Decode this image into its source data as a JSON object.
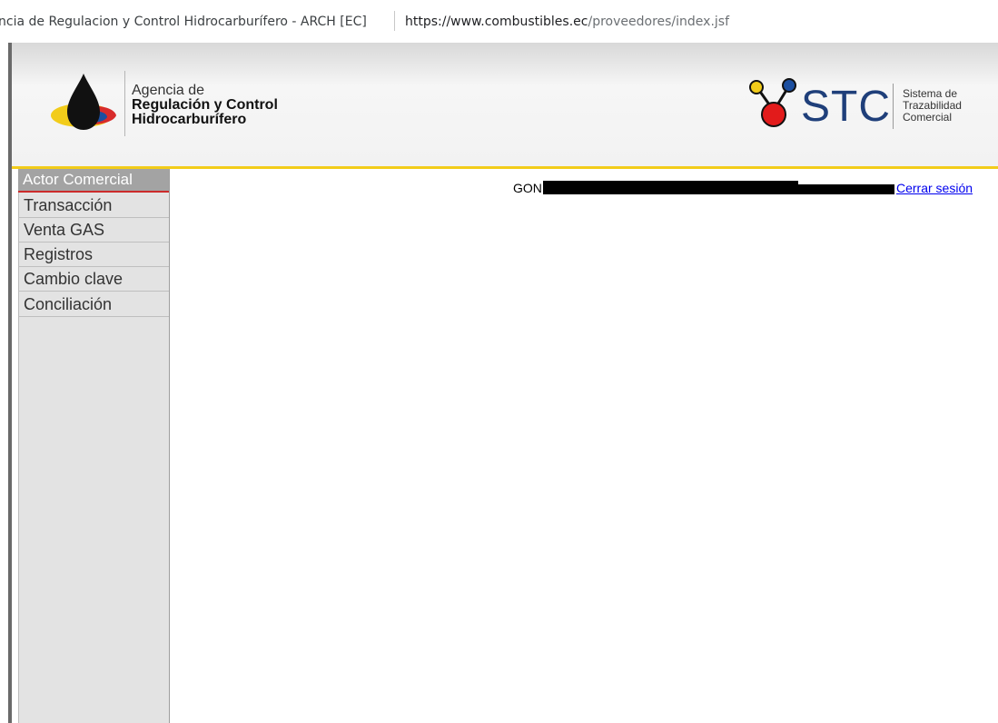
{
  "browser": {
    "site_title": "ncia de Regulacion y Control Hidrocarburífero - ARCH [EC]",
    "url_host": "https://www.combustibles.ec",
    "url_path": "/proveedores/index.jsf"
  },
  "header": {
    "arch_line1": "Agencia de",
    "arch_line2": "Regulación y Control",
    "arch_line3": "Hidrocarburífero",
    "stc_word": "STC",
    "stc_sub1": "Sistema de",
    "stc_sub2": "Trazabilidad",
    "stc_sub3": "Comercial"
  },
  "sidebar": {
    "heading": "Actor Comercial",
    "items": [
      {
        "label": "Transacción"
      },
      {
        "label": "Venta GAS"
      },
      {
        "label": "Registros"
      },
      {
        "label": "Cambio clave"
      },
      {
        "label": "Conciliación"
      }
    ]
  },
  "user": {
    "name_prefix": "GON",
    "logout_label": "Cerrar sesión"
  },
  "colors": {
    "header_accent": "#f2cc1a",
    "menu_head_bg": "#a3a3a3",
    "menu_head_border": "#cc2b2b",
    "sidebar_bg": "#e3e3e3",
    "link": "#0000ee"
  }
}
